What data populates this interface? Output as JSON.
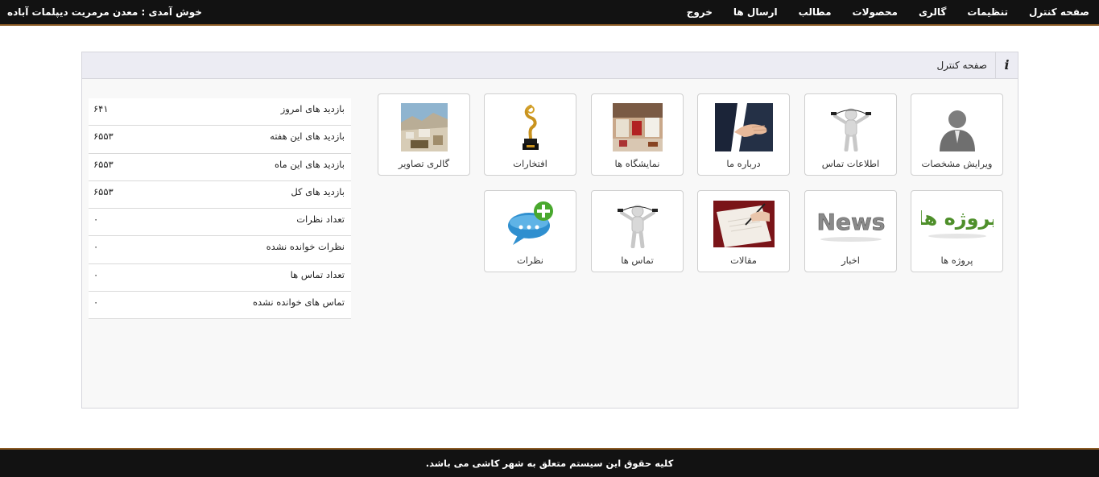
{
  "topbar": {
    "nav": [
      {
        "id": "control-panel",
        "label": "صفحه کنترل"
      },
      {
        "id": "settings",
        "label": "تنظیمات"
      },
      {
        "id": "gallery",
        "label": "گالری"
      },
      {
        "id": "products",
        "label": "محصولات"
      },
      {
        "id": "articles",
        "label": "مطالب"
      },
      {
        "id": "messages",
        "label": "ارسال ها"
      },
      {
        "id": "logout",
        "label": "خروج"
      }
    ],
    "welcome": "خوش آمدی : معدن مرمریت دیپلمات آباده"
  },
  "panel": {
    "title": "صفحه کنترل",
    "info_icon": "info-icon",
    "tiles_row1": [
      {
        "label": "ویرایش مشخصات",
        "icon": "user-silhouette-icon"
      },
      {
        "label": "اطلاعات تماس",
        "icon": "phone-figure-icon"
      },
      {
        "label": "درباره ما",
        "icon": "handshake-icon"
      },
      {
        "label": "نمایشگاه ها",
        "icon": "exhibition-photo-icon"
      },
      {
        "label": "افتخارات",
        "icon": "trophy-icon"
      },
      {
        "label": "گالری تصاویر",
        "icon": "quarry-photo-icon"
      }
    ],
    "tiles_row2": [
      {
        "label": "پروژه ها",
        "icon": "projects-text-icon",
        "icon_text": "پروژه ها"
      },
      {
        "label": "اخبار",
        "icon": "news-icon",
        "icon_text": "News"
      },
      {
        "label": "مقالات",
        "icon": "writing-hand-icon"
      },
      {
        "label": "تماس ها",
        "icon": "phone-figure-icon"
      },
      {
        "label": "نظرات",
        "icon": "comment-add-icon"
      }
    ]
  },
  "stats": [
    {
      "label": "بازدید های امروز",
      "value": "۶۴۱"
    },
    {
      "label": "بازدید های این هفته",
      "value": "۶۵۵۳"
    },
    {
      "label": "بازدید های این ماه",
      "value": "۶۵۵۳"
    },
    {
      "label": "بازدید های کل",
      "value": "۶۵۵۳"
    },
    {
      "label": "تعداد نظرات",
      "value": "۰"
    },
    {
      "label": "نظرات خوانده نشده",
      "value": "۰"
    },
    {
      "label": "تعداد تماس ها",
      "value": "۰"
    },
    {
      "label": "تماس های خوانده نشده",
      "value": "۰"
    }
  ],
  "footer": {
    "text": "کلیه حقوق این سیستم متعلق به شهر کاشی می باشد."
  },
  "colors": {
    "bar_bg": "#121212",
    "bar_border": "#8a5a24",
    "panel_bg": "#f8f8f8",
    "panel_header_bg": "#ececf3"
  }
}
